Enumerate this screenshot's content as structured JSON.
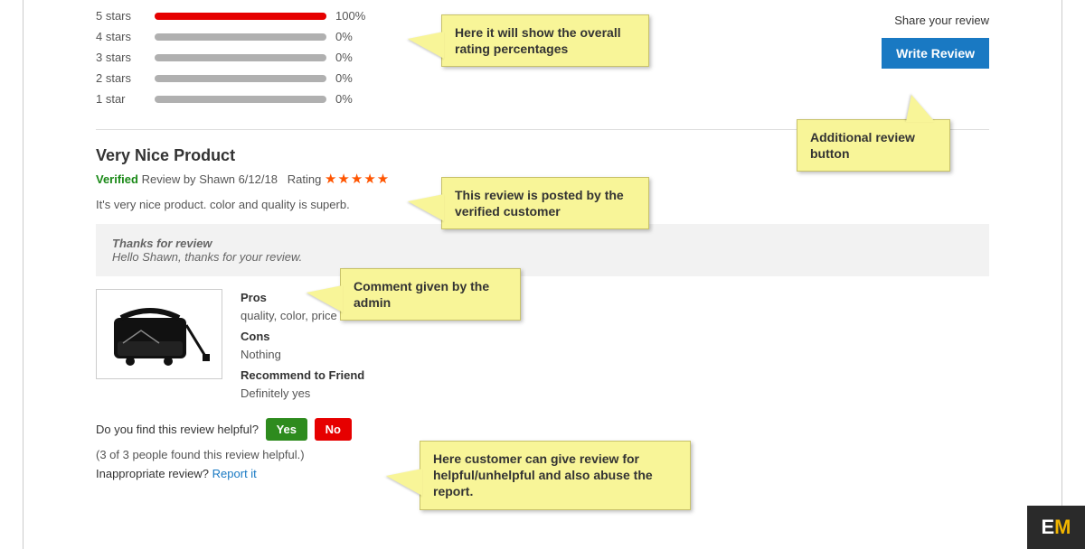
{
  "ratings": [
    {
      "label": "5 stars",
      "pct": "100%",
      "fill": 100
    },
    {
      "label": "4 stars",
      "pct": "0%",
      "fill": 0
    },
    {
      "label": "3 stars",
      "pct": "0%",
      "fill": 0
    },
    {
      "label": "2 stars",
      "pct": "0%",
      "fill": 0
    },
    {
      "label": "1 star",
      "pct": "0%",
      "fill": 0
    }
  ],
  "share": {
    "text": "Share your review",
    "button": "Write Review"
  },
  "review": {
    "title": "Very Nice Product",
    "verified": "Verified",
    "meta_prefix": "Review by",
    "author": "Shawn",
    "date": "6/12/18",
    "rating_label": "Rating",
    "stars": "★★★★★",
    "body": "It's very nice product. color and quality is superb."
  },
  "admin_comment": {
    "title": "Thanks for review",
    "body": "Hello Shawn, thanks for your review."
  },
  "details": {
    "pros_label": "Pros",
    "pros_value": "quality, color, price",
    "cons_label": "Cons",
    "cons_value": "Nothing",
    "rec_label": "Recommend to Friend",
    "rec_value": "Definitely yes"
  },
  "helpful": {
    "question": "Do you find this review helpful?",
    "yes": "Yes",
    "no": "No",
    "count": "(3 of 3 people found this review helpful.)",
    "inappropriate": "Inappropriate review?",
    "report": "Report it"
  },
  "callouts": {
    "c1": "Here it will show the overall rating percentages",
    "c2": "Additional review button",
    "c3": "This review is posted by the verified customer",
    "c4": "Comment given by the admin",
    "c5": "Here customer can give review for helpful/unhelpful and also abuse the report."
  },
  "logo": {
    "e": "E",
    "m": "M"
  }
}
